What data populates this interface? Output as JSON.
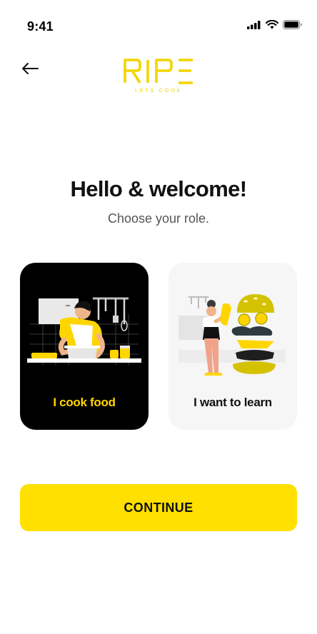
{
  "status_bar": {
    "time": "9:41"
  },
  "header": {
    "back_icon": "arrow-left-icon",
    "logo_text": "RIPE",
    "logo_tagline": "LETS COOK",
    "brand_color": "#f4d400"
  },
  "main": {
    "title": "Hello & welcome!",
    "subtitle": "Choose your role."
  },
  "roles": [
    {
      "label": "I cook food",
      "selected": true,
      "illustration": "chef-cooking-illustration"
    },
    {
      "label": "I want to learn",
      "selected": false,
      "illustration": "burger-learner-illustration"
    }
  ],
  "footer": {
    "continue_label": "CONTINUE",
    "button_color": "#ffe000"
  }
}
